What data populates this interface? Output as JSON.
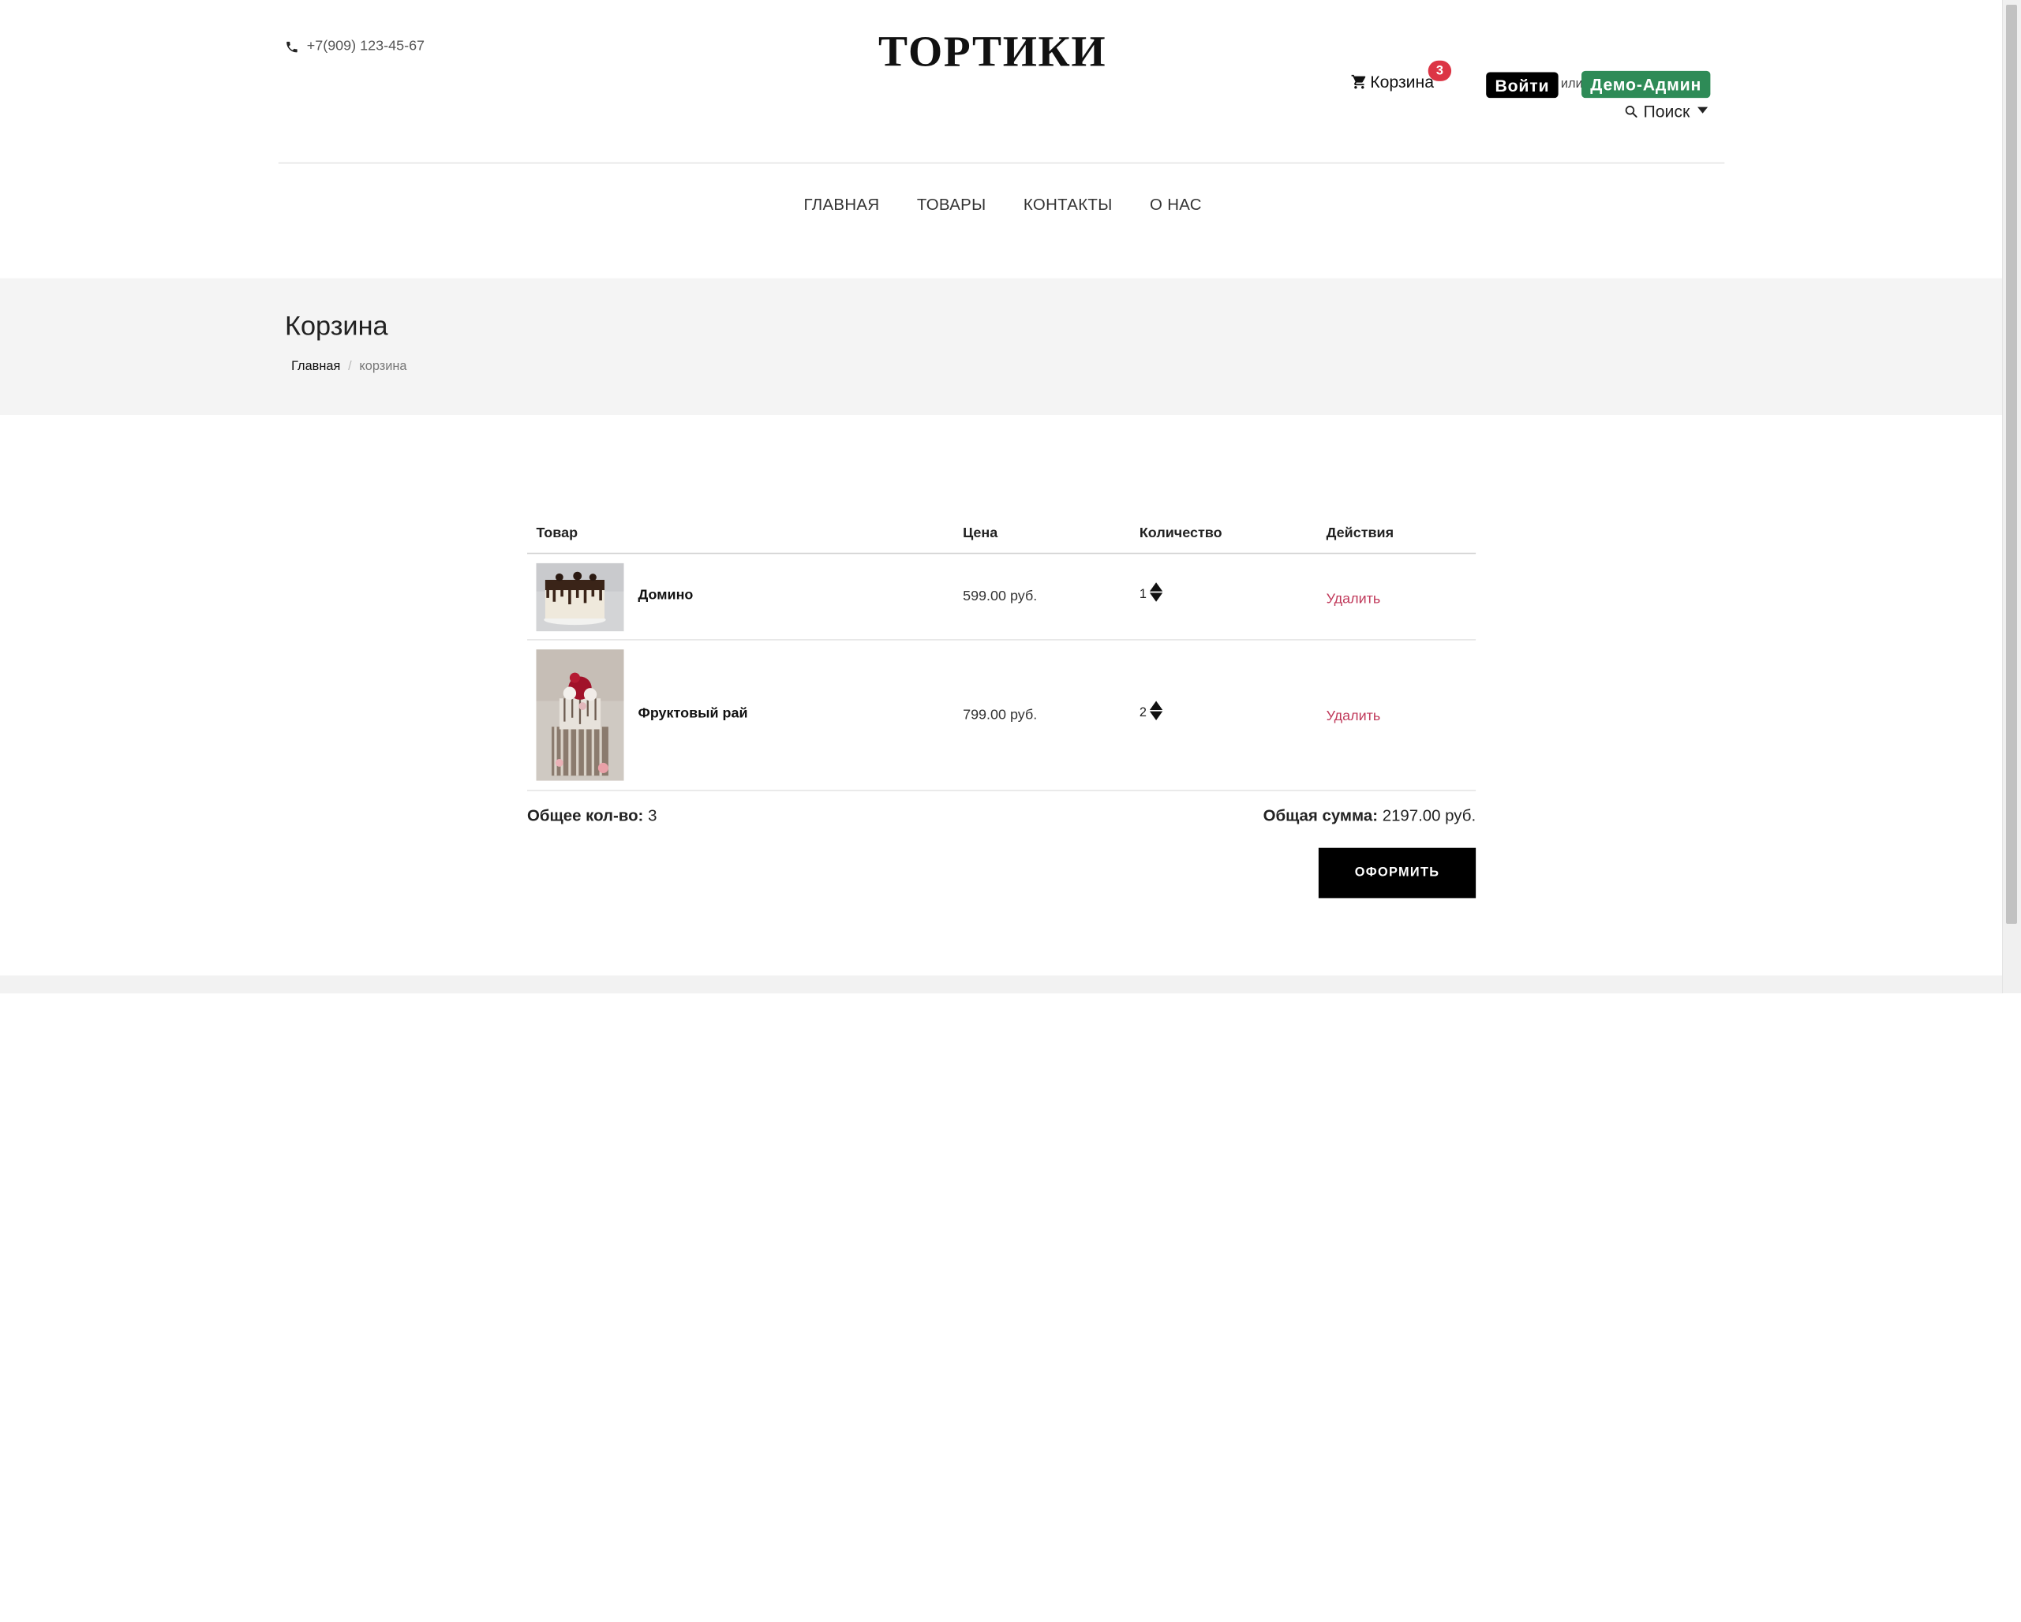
{
  "header": {
    "phone": "+7(909) 123-45-67",
    "brand": "ТОРТИКИ",
    "cart_label": "Корзина",
    "cart_count": "3",
    "login_label": "Войти",
    "or_label": "или",
    "demo_label": "Демо-Админ",
    "search_label": "Поиск"
  },
  "nav": {
    "items": [
      "ГЛАВНАЯ",
      "ТОВАРЫ",
      "КОНТАКТЫ",
      "О НАС"
    ]
  },
  "hero": {
    "title": "Корзина",
    "breadcrumb_home": "Главная",
    "breadcrumb_sep": "/",
    "breadcrumb_current": "корзина"
  },
  "cart": {
    "headers": [
      "Товар",
      "Цена",
      "Количество",
      "Действия"
    ],
    "items": [
      {
        "name": "Домино",
        "price": "599.00 руб.",
        "qty": "1",
        "action": "Удалить"
      },
      {
        "name": "Фруктовый рай",
        "price": "799.00 руб.",
        "qty": "2",
        "action": "Удалить"
      }
    ],
    "total_qty_label": "Общее кол-во:",
    "total_qty": "3",
    "total_sum_label": "Общая сумма:",
    "total_sum": "2197.00 руб.",
    "checkout_label": "ОФОРМИТЬ"
  },
  "colors": {
    "demo_button": "#2e8b57",
    "badge": "#dc3545",
    "delete_link": "#c0395a",
    "hero_bg": "#f4f4f4"
  }
}
